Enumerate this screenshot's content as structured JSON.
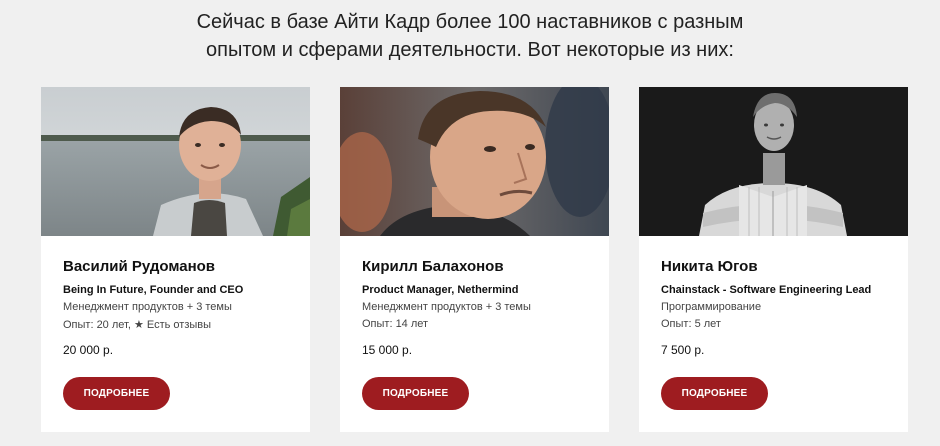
{
  "header": {
    "line1": "Сейчас в базе Айти Кадр более 100 наставников с разным",
    "line2": "опытом и сферами деятельности. Вот некоторые из них:"
  },
  "mentors": [
    {
      "name": "Василий Рудоманов",
      "role": "Being In Future, Founder and CEO",
      "topics": "Менеджмент продуктов + 3 темы",
      "experience": "Опыт: 20 лет, ★ Есть отзывы",
      "price": "20 000 р.",
      "button_label": "ПОДРОБНЕЕ"
    },
    {
      "name": "Кирилл Балахонов",
      "role": "Product Manager, Nethermind",
      "topics": "Менеджмент продуктов + 3 темы",
      "experience": "Опыт: 14 лет",
      "price": "15 000 р.",
      "button_label": "ПОДРОБНЕЕ"
    },
    {
      "name": "Никита Югов",
      "role": "Chainstack - Software Engineering Lead",
      "topics": "Программирование",
      "experience": "Опыт: 5 лет",
      "price": "7 500 р.",
      "button_label": "ПОДРОБНЕЕ"
    }
  ],
  "colors": {
    "page_background": "#f0f0f0",
    "card_background": "#ffffff",
    "button_background": "#9e1c20",
    "button_text": "#ffffff"
  }
}
